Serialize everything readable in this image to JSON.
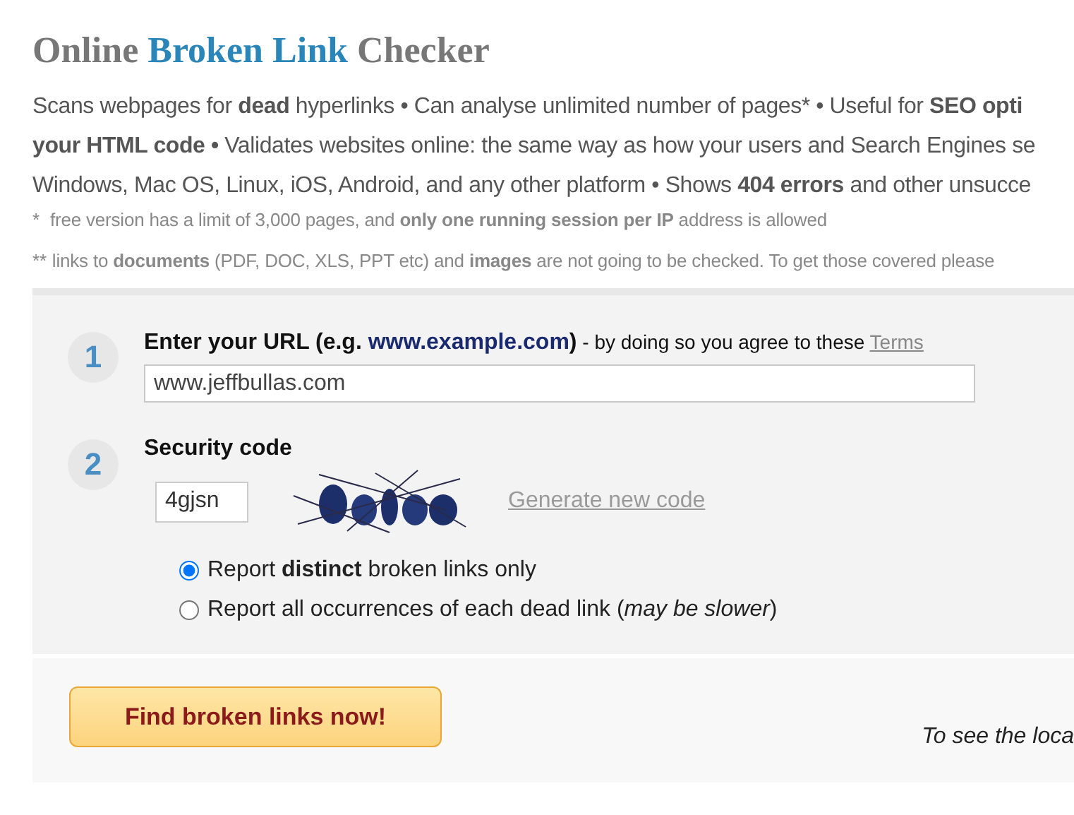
{
  "title": [
    {
      "text": "Online",
      "kind": "plain"
    },
    {
      "text": "Broken Link",
      "kind": "accent"
    },
    {
      "text": "Checker",
      "kind": "plain"
    }
  ],
  "intro_lines": [
    "Scans webpages for **dead** hyperlinks • Can analyse unlimited number of pages* • Useful for **SEO opti**",
    "**your HTML code •** Validates websites online: the same way as how your users and Search Engines se",
    "Windows, Mac OS, Linux, iOS, Android, and any other platform • Shows **404 errors** and other unsucce"
  ],
  "footnotes": [
    {
      "mark": "*",
      "text": " free version has a limit of 3,000 pages, and **only one running session per IP** address is allowed"
    },
    {
      "mark": "**",
      "text": "links to **documents** (PDF, DOC, XLS, PPT etc) and **images** are not going to be checked. To get those covered please"
    }
  ],
  "form": {
    "step1": {
      "number": "1",
      "label": "Enter your URL (e.g. ",
      "example": "www.example.com",
      "label_end": ")",
      "note": " - by doing so you agree to these ",
      "terms_link": "Terms",
      "value": "www.jeffbullas.com"
    },
    "step2": {
      "number": "2",
      "label": "Security code",
      "value": "4gjsn",
      "generate_link": "Generate new code"
    },
    "options": [
      {
        "text": "Report **distinct** broken links only",
        "selected": true
      },
      {
        "text": "Report all occurrences of each dead link (*may be slower*)",
        "selected": false
      }
    ]
  },
  "submit_button": "Find broken links now!",
  "side_note": "To see the loca"
}
